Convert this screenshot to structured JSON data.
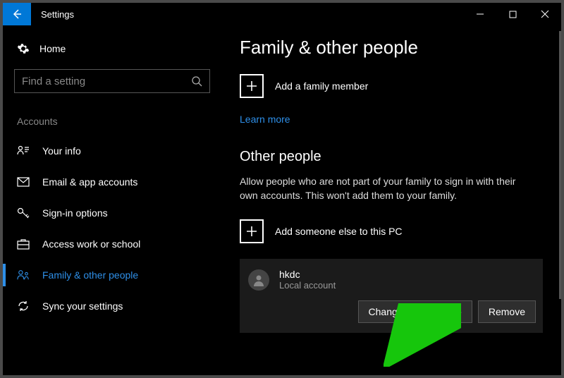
{
  "titlebar": {
    "title": "Settings"
  },
  "sidebar": {
    "home_label": "Home",
    "search_placeholder": "Find a setting",
    "section_label": "Accounts",
    "items": [
      {
        "label": "Your info"
      },
      {
        "label": "Email & app accounts"
      },
      {
        "label": "Sign-in options"
      },
      {
        "label": "Access work or school"
      },
      {
        "label": "Family & other people"
      },
      {
        "label": "Sync your settings"
      }
    ],
    "selected_index": 4
  },
  "main": {
    "heading": "Family & other people",
    "add_family_label": "Add a family member",
    "learn_more": "Learn more",
    "other_heading": "Other people",
    "other_desc": "Allow people who are not part of your family to sign in with their own accounts. This won't add them to your family.",
    "add_other_label": "Add someone else to this PC",
    "user": {
      "name": "hkdc",
      "subtitle": "Local account"
    },
    "buttons": {
      "change": "Change account type",
      "remove": "Remove"
    }
  }
}
